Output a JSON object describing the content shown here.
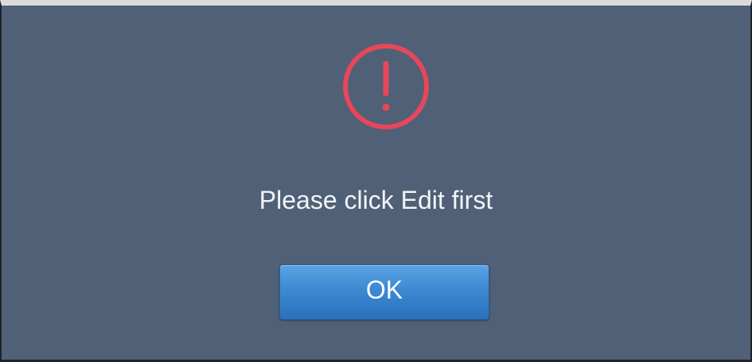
{
  "dialog": {
    "icon": "alert-circle-icon",
    "message": "Please click Edit first",
    "ok_label": "OK"
  },
  "colors": {
    "dialog_background": "#506077",
    "alert_icon": "#e6475a",
    "button": "#3d89d2",
    "text": "#f2f4f7"
  }
}
